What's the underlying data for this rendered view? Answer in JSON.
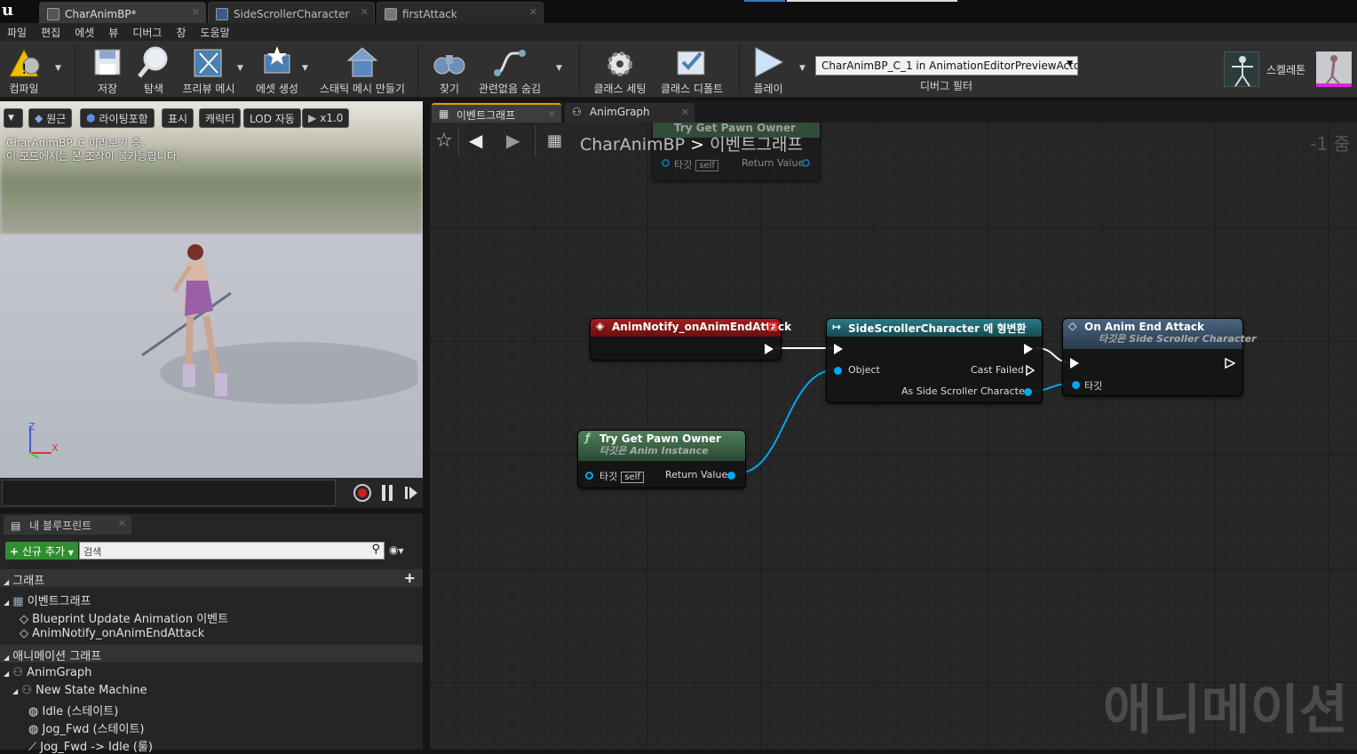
{
  "titlebar": {
    "tabs": [
      {
        "label": "CharAnimBP*",
        "active": true
      },
      {
        "label": "SideScrollerCharacter",
        "active": false
      },
      {
        "label": "firstAttack",
        "active": false
      }
    ]
  },
  "menu": [
    "파일",
    "편집",
    "에셋",
    "뷰",
    "디버그",
    "창",
    "도움말"
  ],
  "toolbar": {
    "compile": "컴파일",
    "save": "저장",
    "browse": "탐색",
    "preview_mesh": "프리뷰 메시",
    "create_asset": "에셋 생성",
    "make_static_mesh": "스태틱 메시 만들기",
    "find": "찾기",
    "hide_unrelated": "관련없음 숨김",
    "class_settings": "클래스 세팅",
    "class_defaults": "클래스 디폴트",
    "play": "플레이",
    "debug_object": "CharAnimBP_C_1 in AnimationEditorPreviewActor",
    "debug_filter": "디버그 필터",
    "skeleton": "스켈레톤"
  },
  "viewport": {
    "buttons": [
      "원근",
      "라이팅포함",
      "표시",
      "캐릭터",
      "LOD 자동",
      "x1.0"
    ],
    "info_line1": "CharAnimBP_C 미리보기 중.",
    "info_line2": "이 모드에서는 본 조작이 불가능합니다.",
    "axis_z": "Z",
    "axis_x": "X"
  },
  "my_blueprint": {
    "tab_label": "내 블루프린트",
    "add_new": "신규 추가",
    "search_placeholder": "검색",
    "graphs_header": "그래프",
    "event_graph": "이벤트그래프",
    "event_items": [
      "Blueprint Update Animation 이벤트",
      "AnimNotify_onAnimEndAttack"
    ],
    "anim_graphs_header": "애니메이션 그래프",
    "anim_graph": "AnimGraph",
    "state_machine": "New State Machine",
    "states": [
      "Idle (스테이트)",
      "Jog_Fwd (스테이트)",
      "Jog_Fwd -> Idle (룰)"
    ]
  },
  "graph": {
    "tabs": [
      "이벤트그래프",
      "AnimGraph"
    ],
    "breadcrumb_root": "CharAnimBP",
    "breadcrumb_sep": ">",
    "breadcrumb_current": "이벤트그래프",
    "zoom": "-1 줌",
    "watermark": "애니메이션",
    "ghost_node": {
      "title": "Try Get Pawn Owner",
      "target": "타깃",
      "self": "self",
      "return": "Return Value"
    },
    "node_notify": {
      "title": "AnimNotify_onAnimEndAttack"
    },
    "node_cast": {
      "title": "SideScrollerCharacter 에 형변환",
      "object": "Object",
      "cast_failed": "Cast Failed",
      "as_char": "As Side Scroller Character"
    },
    "node_attack": {
      "title": "On Anim End Attack",
      "subtitle": "타깃은 Side Scroller Character",
      "target": "타깃"
    },
    "node_pawn": {
      "title": "Try Get Pawn Owner",
      "subtitle": "타깃은 Anim Instance",
      "target": "타깃",
      "self": "self",
      "return": "Return Value"
    }
  },
  "colors": {
    "event_node": "#8b1a1a",
    "cast_node": "#1d5e66",
    "function_node": "#3d6b4a",
    "attack_node": "#3a5068",
    "data_pin": "#00a8f0",
    "add_button": "#2f8f2f"
  }
}
